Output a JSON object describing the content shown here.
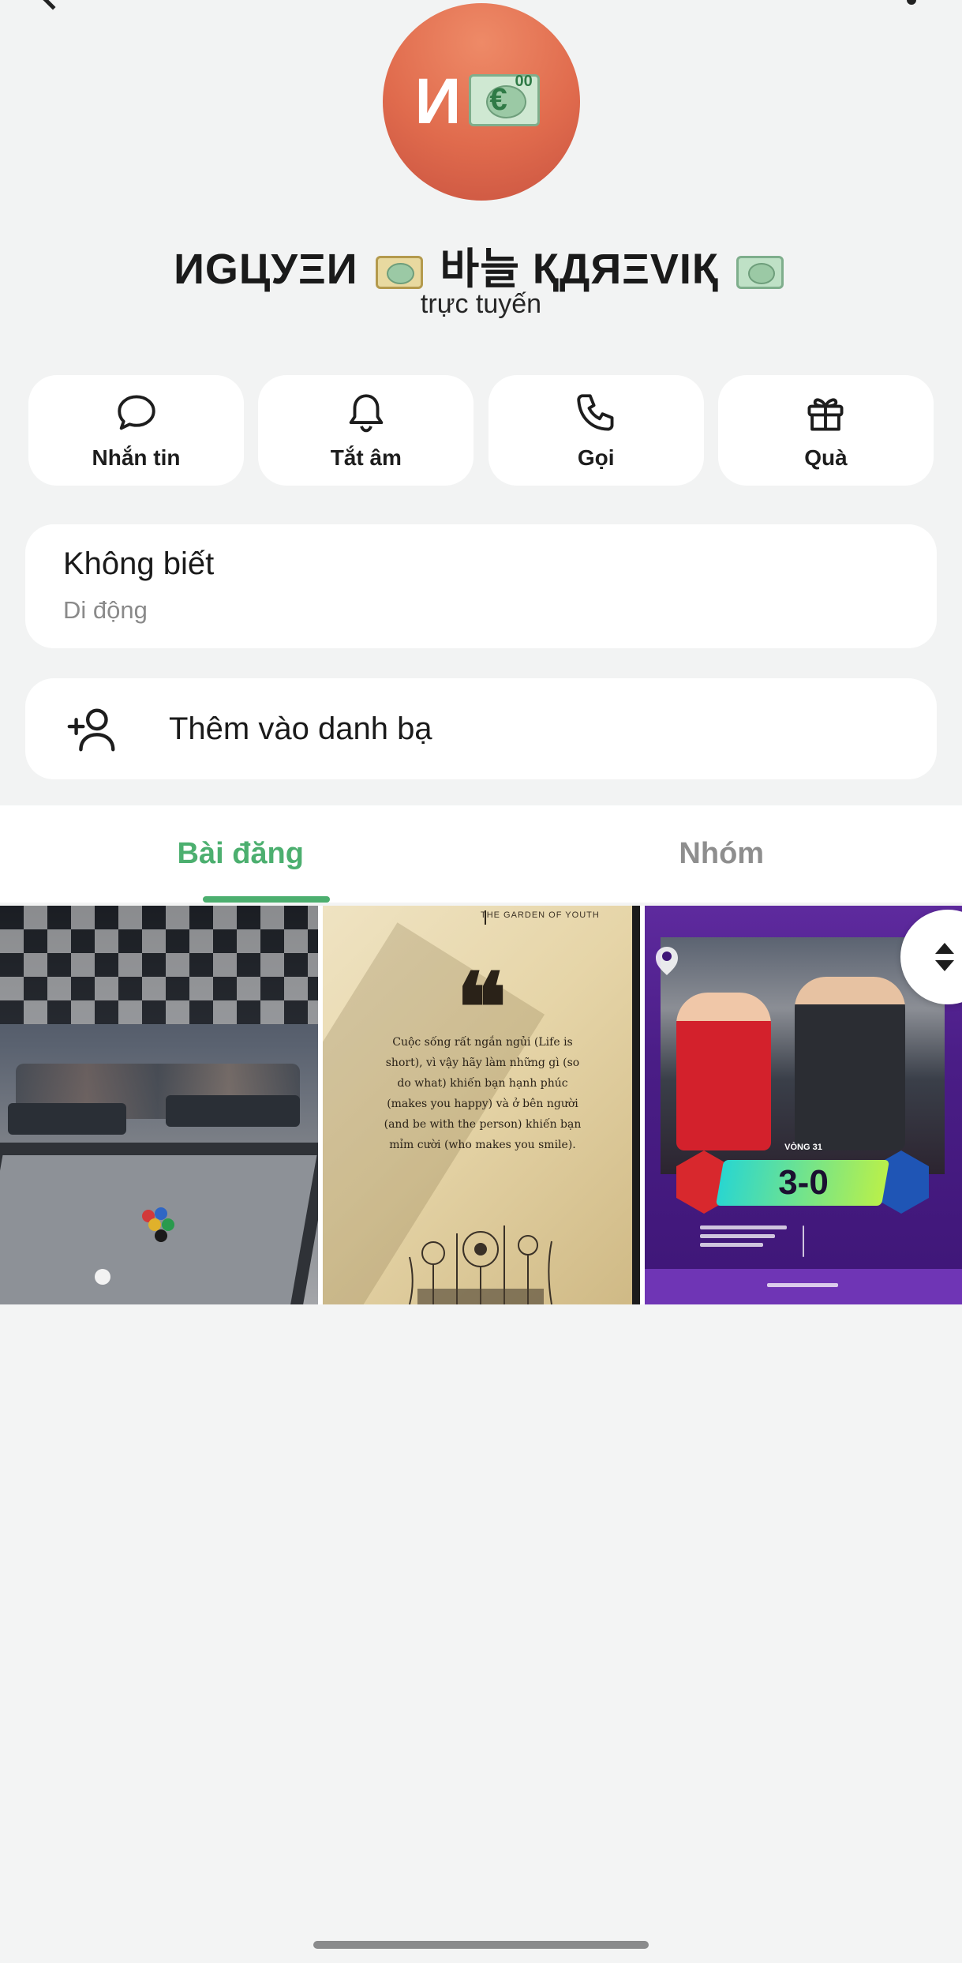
{
  "profile": {
    "avatar_text": "И",
    "name_parts": [
      "ИGЦУΞИ",
      "바늘 ҚДЯΞVIҚ"
    ],
    "status": "trực tuyến"
  },
  "actions": [
    {
      "label": "Nhắn tin",
      "icon": "chat-bubble-icon"
    },
    {
      "label": "Tắt âm",
      "icon": "bell-icon"
    },
    {
      "label": "Gọi",
      "icon": "phone-icon"
    },
    {
      "label": "Quà",
      "icon": "gift-icon"
    }
  ],
  "phone_info": {
    "value": "Không biết",
    "label": "Di động"
  },
  "add_contact": {
    "label": "Thêm vào danh bạ",
    "icon": "add-person-icon"
  },
  "tabs": [
    {
      "label": "Bài đăng",
      "active": true
    },
    {
      "label": "Nhóm",
      "active": false
    }
  ],
  "media": {
    "quote_post": {
      "book_title": "THE GARDEN OF YOUTH",
      "text": "Cuộc sống rất ngắn ngủi (Life is short), vì vậy hãy làm những gì (so do what) khiến bạn hạnh phúc (makes you happy) và ở bên người (and be with the person) khiến bạn mỉm cười (who makes you smile)."
    },
    "football_post": {
      "round": "VÒNG 31",
      "score": "3-0"
    }
  },
  "colors": {
    "accent": "#4caf6f",
    "avatar": "#e06b4d",
    "background": "#f2f3f3"
  }
}
